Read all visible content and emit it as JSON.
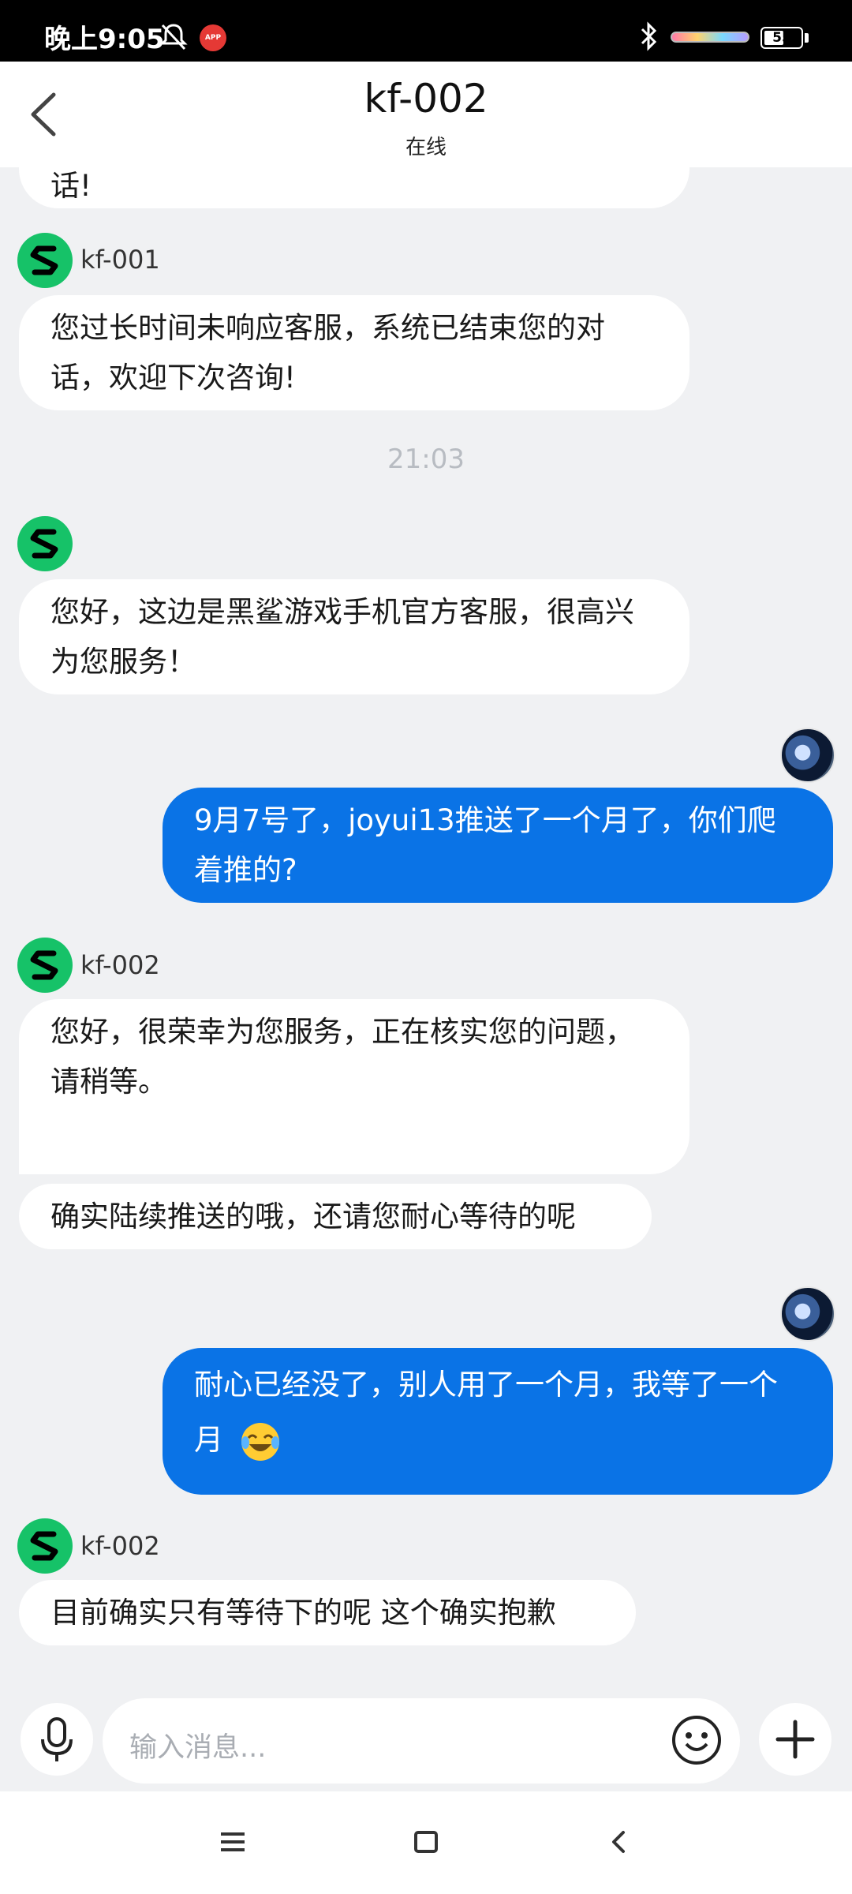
{
  "status_bar": {
    "time": "晚上9:05",
    "notif_badge": "APP",
    "battery": "55"
  },
  "header": {
    "title": "kf-002",
    "subtitle": "在线"
  },
  "messages": {
    "m0": {
      "text": "话!"
    },
    "m1": {
      "sender": "kf-001",
      "text": "您过长时间未响应客服，系统已结束您的对话，欢迎下次咨询!"
    },
    "time_sep": "21:03",
    "m2": {
      "text": "您好，这边是黑鲨游戏手机官方客服，很高兴为您服务！"
    },
    "m3": {
      "text": "9月7号了，joyui13推送了一个月了，你们爬着推的?"
    },
    "m4": {
      "sender": "kf-002",
      "text": "您好，很荣幸为您服务，正在核实您的问题，请稍等。"
    },
    "m5": {
      "text": "确实陆续推送的哦，还请您耐心等待的呢"
    },
    "m6": {
      "text": "耐心已经没了，别人用了一个月，我等了一个月"
    },
    "m7": {
      "sender": "kf-002",
      "text": "目前确实只有等待下的呢 这个确实抱歉"
    }
  },
  "input": {
    "placeholder": "输入消息..."
  },
  "colors": {
    "accent": "#0a73e6",
    "agent_avatar": "#16c268",
    "background": "#f0f1f3"
  },
  "icons": [
    "back-icon",
    "mic-icon",
    "emoji-icon",
    "plus-icon",
    "menu-icon",
    "home-icon",
    "nav-back-icon"
  ]
}
